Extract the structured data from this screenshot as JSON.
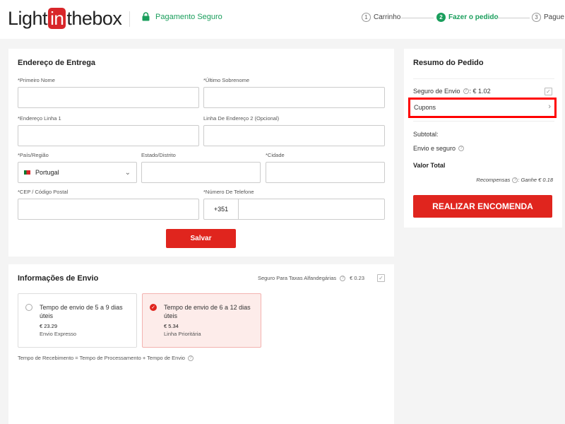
{
  "header": {
    "logo": {
      "pre": "Light",
      "in": "in",
      "post": "thebox"
    },
    "secure_label": "Pagamento Seguro",
    "steps": [
      {
        "num": "1",
        "label": "Carrinho"
      },
      {
        "num": "2",
        "label": "Fazer o pedido"
      },
      {
        "num": "3",
        "label": "Pague"
      }
    ],
    "active_step": 2
  },
  "address": {
    "title": "Endereço de Entrega",
    "fields": {
      "first_name": {
        "label": "*Primeiro Nome",
        "value": ""
      },
      "last_name": {
        "label": "*Último Sobrenome",
        "value": ""
      },
      "address1": {
        "label": "*Endereço Linha 1",
        "value": ""
      },
      "address2": {
        "label": "Linha De Endereço 2 (Opcional)",
        "value": ""
      },
      "country": {
        "label": "*País/Região",
        "value": "Portugal"
      },
      "state": {
        "label": "Estado/Distrito",
        "value": ""
      },
      "city": {
        "label": "*Cidade",
        "value": ""
      },
      "zip": {
        "label": "*CEP / Código Postal",
        "value": ""
      },
      "phone": {
        "label": "*Número De Telefone",
        "prefix": "+351",
        "value": ""
      }
    },
    "save_label": "Salvar"
  },
  "shipping": {
    "title": "Informações de Envio",
    "customs_label": "Seguro Para Taxas Alfandegárias",
    "customs_price": "€ 0.23",
    "options": [
      {
        "title": "Tempo de envio de 5 a 9 dias úteis",
        "price": "€ 23.29",
        "desc": "Envio Expresso",
        "selected": false
      },
      {
        "title": "Tempo de envio de 6 a 12 dias úteis",
        "price": "€ 5.34",
        "desc": "Linha Prioritária",
        "selected": true
      }
    ],
    "note": "Tempo de Recebimento = Tempo de Processamento + Tempo de Envio"
  },
  "summary": {
    "title": "Resumo do Pedido",
    "insurance_label": "Seguro de Envio",
    "insurance_price": ": € 1.02",
    "coupons_label": "Cupons",
    "subtotal_label": "Subtotal:",
    "shipping_label": "Envio e seguro",
    "total_label": "Valor Total",
    "rewards_label": "Recompensas",
    "rewards_value": ": Ganhe € 0.18",
    "place_order_label": "REALIZAR ENCOMENDA"
  },
  "colors": {
    "accent_red": "#e0251e",
    "secure_green": "#1a9e5c",
    "highlight": "#ff0000"
  }
}
